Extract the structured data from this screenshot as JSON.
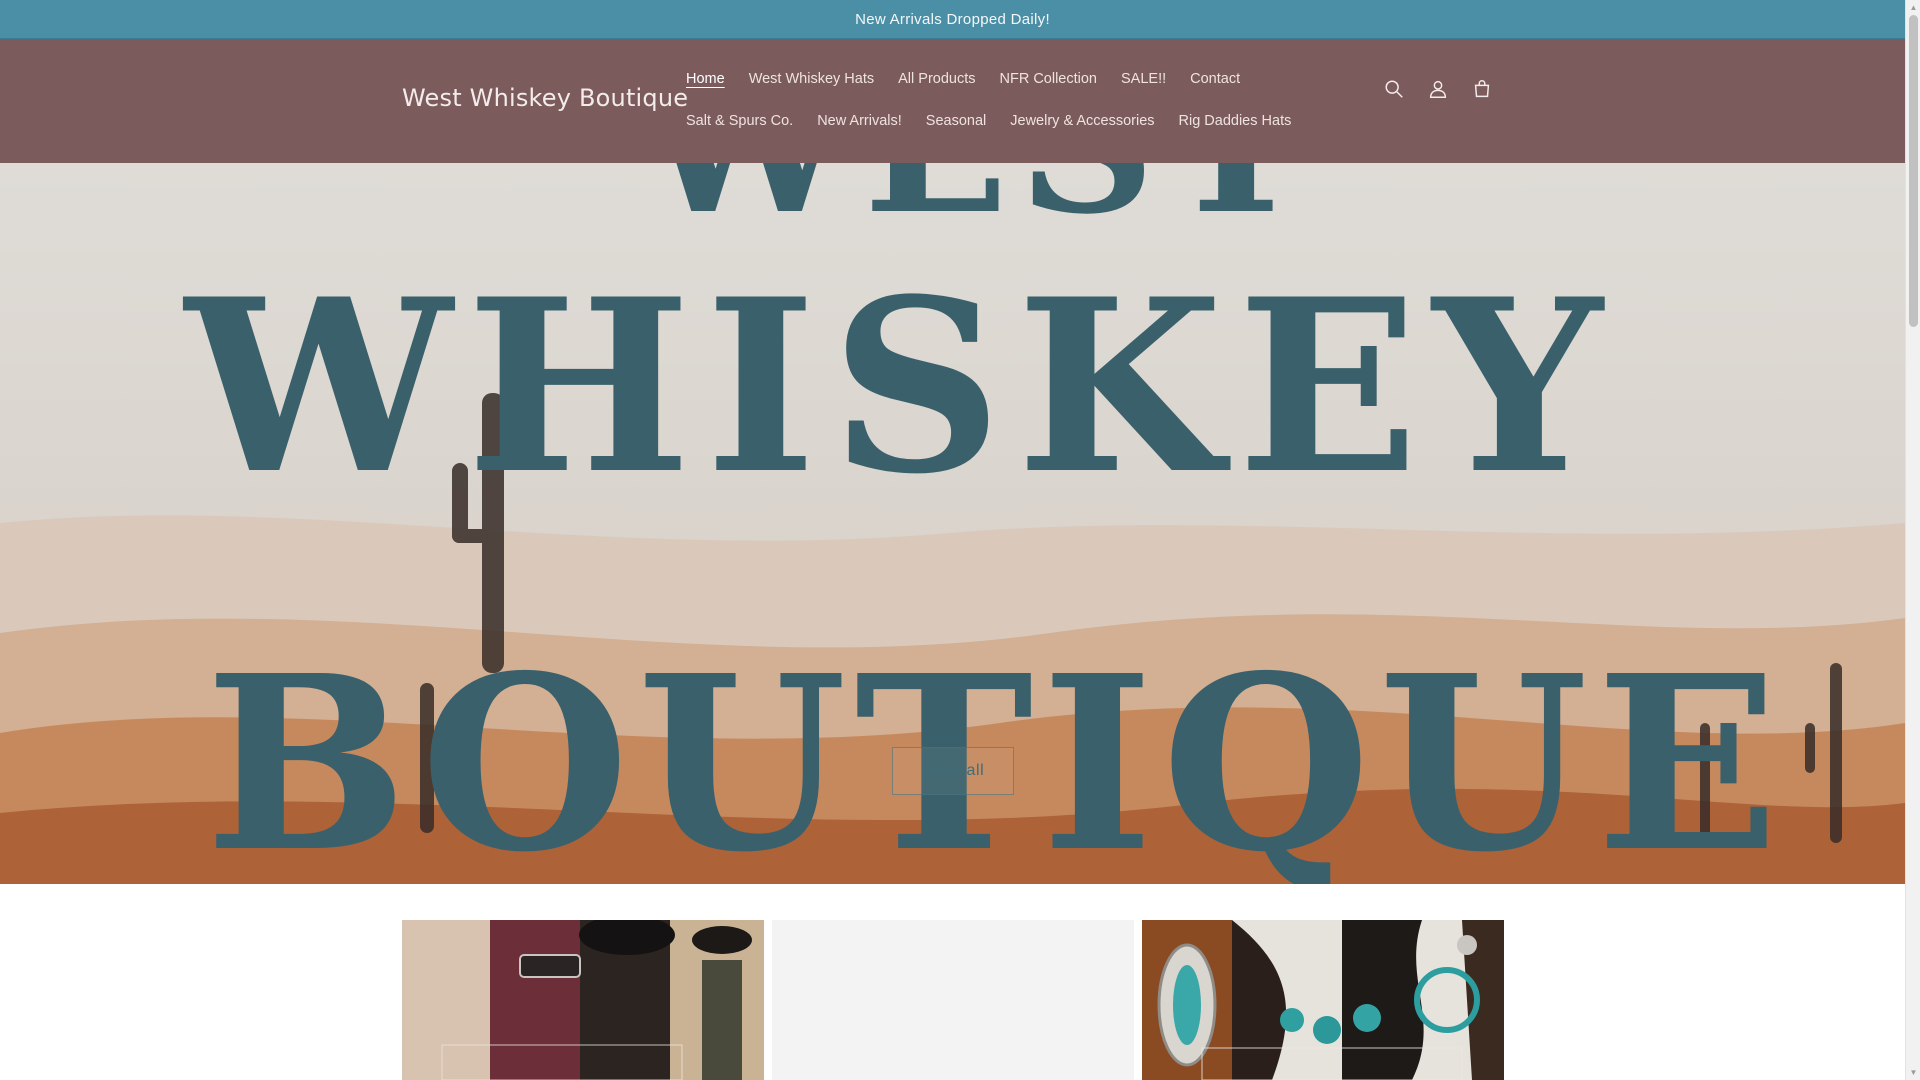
{
  "announcement": {
    "text": "New Arrivals Dropped Daily!"
  },
  "header": {
    "logo": "West Whiskey Boutique",
    "nav_row_1": [
      {
        "label": "Home",
        "active": true
      },
      {
        "label": "West Whiskey Hats"
      },
      {
        "label": "All Products"
      },
      {
        "label": "NFR Collection"
      },
      {
        "label": "SALE!!"
      },
      {
        "label": "Contact"
      }
    ],
    "nav_row_2": [
      {
        "label": "Salt & Spurs Co."
      },
      {
        "label": "New Arrivals!"
      },
      {
        "label": "Seasonal"
      },
      {
        "label": "Jewelry & Accessories"
      },
      {
        "label": "Rig Daddies Hats"
      }
    ],
    "icons": [
      "search-icon",
      "account-icon",
      "cart-icon"
    ]
  },
  "hero": {
    "banner_words": [
      "WEST",
      "WHISKEY",
      "BOUTIQUE"
    ],
    "cta_label": "Shop all"
  },
  "colors": {
    "announcement_bg": "#4b8fa6",
    "header_bg": "#7b5b5c",
    "hero_text": "#3d6570"
  }
}
